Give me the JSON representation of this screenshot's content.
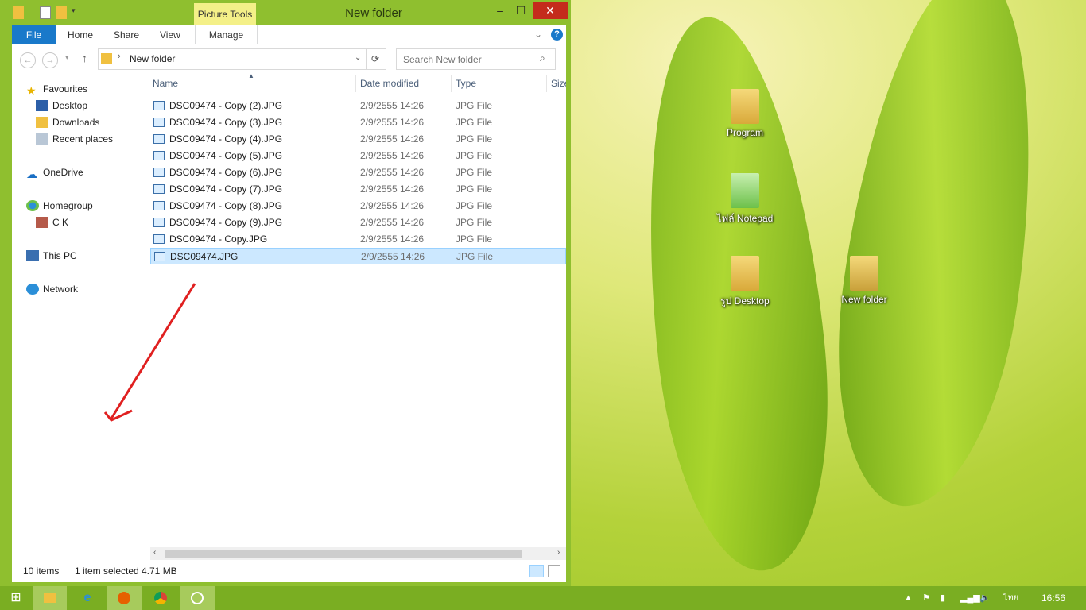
{
  "window": {
    "title": "New folder",
    "contextual_tab_group": "Picture Tools",
    "controls": {
      "minimize": "–",
      "maximize": "☐",
      "close": "✕"
    }
  },
  "ribbon": {
    "tabs": [
      "File",
      "Home",
      "Share",
      "View",
      "Manage"
    ]
  },
  "address": {
    "path": "New folder",
    "search_placeholder": "Search New folder"
  },
  "nav_pane": {
    "favourites": "Favourites",
    "desktop": "Desktop",
    "downloads": "Downloads",
    "recent": "Recent places",
    "onedrive": "OneDrive",
    "homegroup": "Homegroup",
    "user": "C K",
    "this_pc": "This PC",
    "network": "Network"
  },
  "columns": {
    "name": "Name",
    "date": "Date modified",
    "type": "Type",
    "size": "Size"
  },
  "files": [
    {
      "name": "DSC09474 - Copy (2).JPG",
      "date": "2/9/2555 14:26",
      "type": "JPG File"
    },
    {
      "name": "DSC09474 - Copy (3).JPG",
      "date": "2/9/2555 14:26",
      "type": "JPG File"
    },
    {
      "name": "DSC09474 - Copy (4).JPG",
      "date": "2/9/2555 14:26",
      "type": "JPG File"
    },
    {
      "name": "DSC09474 - Copy (5).JPG",
      "date": "2/9/2555 14:26",
      "type": "JPG File"
    },
    {
      "name": "DSC09474 - Copy (6).JPG",
      "date": "2/9/2555 14:26",
      "type": "JPG File"
    },
    {
      "name": "DSC09474 - Copy (7).JPG",
      "date": "2/9/2555 14:26",
      "type": "JPG File"
    },
    {
      "name": "DSC09474 - Copy (8).JPG",
      "date": "2/9/2555 14:26",
      "type": "JPG File"
    },
    {
      "name": "DSC09474 - Copy (9).JPG",
      "date": "2/9/2555 14:26",
      "type": "JPG File"
    },
    {
      "name": "DSC09474 - Copy.JPG",
      "date": "2/9/2555 14:26",
      "type": "JPG File"
    },
    {
      "name": "DSC09474.JPG",
      "date": "2/9/2555 14:26",
      "type": "JPG File",
      "selected": true
    }
  ],
  "status": {
    "items": "10 items",
    "selection": "1 item selected",
    "size": "4.71 MB"
  },
  "desktop_icons": {
    "program": "Program",
    "notepad": "ไฟล์ Notepad",
    "desktop_pics": "รูป Desktop",
    "new_folder": "New folder"
  },
  "tray": {
    "lang": "ไทย",
    "time": "16:56"
  },
  "colors": {
    "accent": "#1979ca",
    "titlebar": "#8fbf2f",
    "taskbar": "#7aae22",
    "close": "#c42b1c",
    "selection": "#cce8ff",
    "annotation_arrow": "#e02020"
  }
}
